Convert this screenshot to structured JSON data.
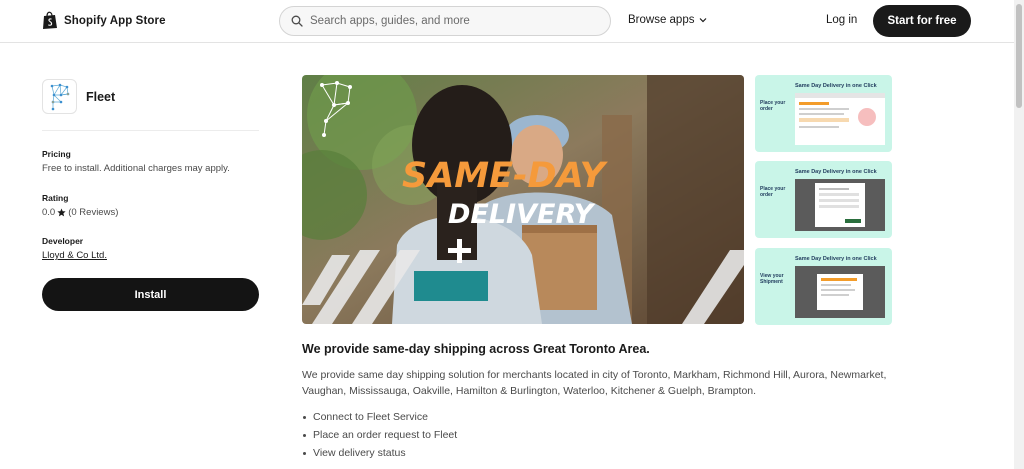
{
  "header": {
    "brand": "Shopify App Store",
    "search_placeholder": "Search apps, guides, and more",
    "browse_label": "Browse apps",
    "login_label": "Log in",
    "start_label": "Start for free"
  },
  "app": {
    "name": "Fleet",
    "pricing_label": "Pricing",
    "pricing_value": "Free to install. Additional charges may apply.",
    "rating_label": "Rating",
    "rating_value": "0.0",
    "rating_reviews": "(0 Reviews)",
    "developer_label": "Developer",
    "developer_name": "Lloyd & Co Ltd.",
    "install_label": "Install"
  },
  "media": {
    "hero_line1": "SAME-DAY",
    "hero_line2": "DELIVERY",
    "thumbnails": [
      {
        "title": "Same Day Delivery in one Click",
        "caption": "Place your order"
      },
      {
        "title": "Same Day Delivery in one Click",
        "caption": "Place your order"
      },
      {
        "title": "Same Day Delivery in one Click",
        "caption": "View your Shipment"
      }
    ]
  },
  "description": {
    "title": "We provide same-day shipping across Great Toronto Area.",
    "body": "We provide same day shipping solution for merchants located in city of Toronto, Markham, Richmond Hill, Aurora, Newmarket, Vaughan, Mississauga, Oakville, Hamilton & Burlington, Waterloo, Kitchener & Guelph, Brampton.",
    "features": [
      "Connect to Fleet Service",
      "Place an order request to Fleet",
      "View delivery status"
    ]
  },
  "colors": {
    "brand_dark": "#1a1a1a",
    "hero_orange": "#f59a3b",
    "teal": "#1f8b8f",
    "thumb_mint": "#c9f5e8"
  },
  "icons": {
    "brand": "shopping-bag-icon",
    "search": "search-icon",
    "browse": "chevron-down-icon",
    "rating": "star-icon"
  }
}
